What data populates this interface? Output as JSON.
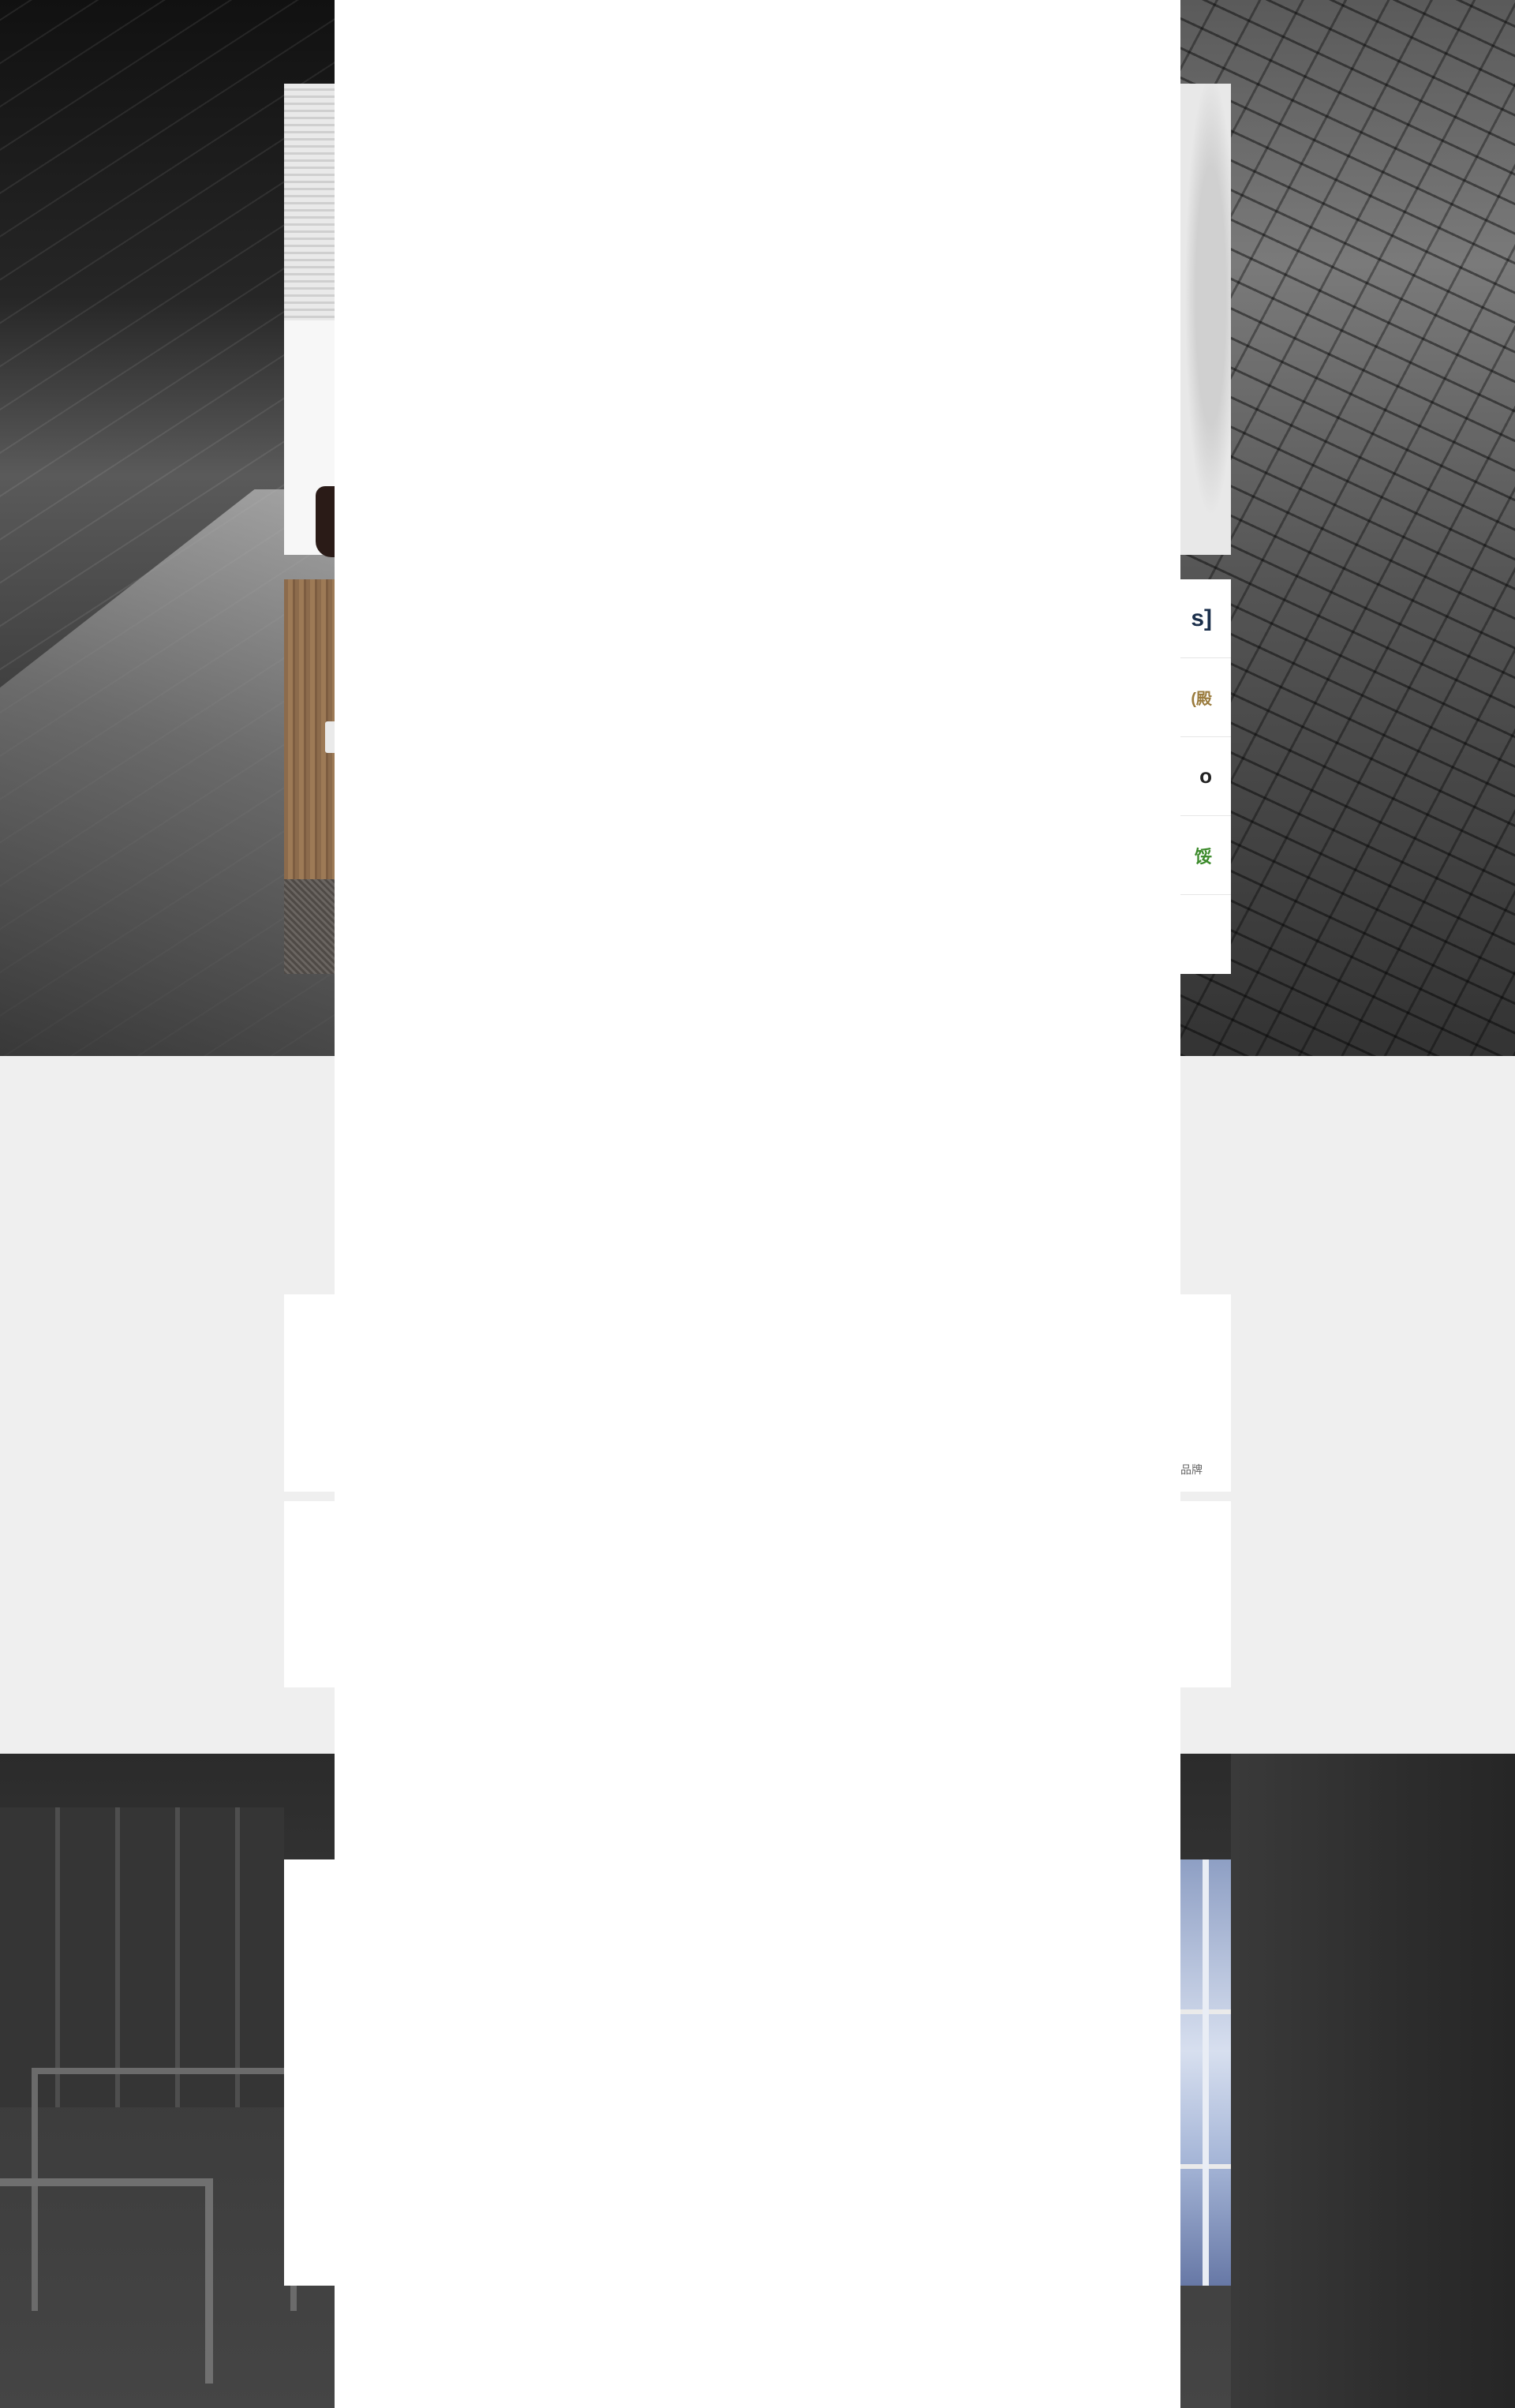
{
  "hero": {
    "logos": [
      {
        "name": "logo-1",
        "text": "s]",
        "color": "#1b2f4b"
      },
      {
        "name": "logo-2",
        "text": "(殿",
        "color": "#9a7b3d"
      },
      {
        "name": "logo-3",
        "text": "o",
        "color": "#222222"
      },
      {
        "name": "logo-4",
        "text": "馁",
        "color": "#3b8a2a"
      }
    ]
  },
  "brands_section": {
    "brand_label": "品牌"
  },
  "colors": {
    "hero_bg": "#3a3a3a",
    "light_bg": "#efefef",
    "card_bg": "#ffffff"
  }
}
